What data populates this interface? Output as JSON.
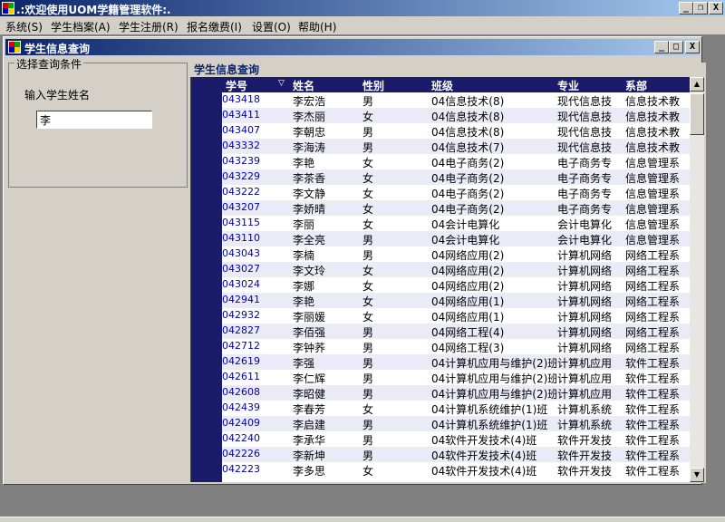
{
  "window": {
    "title": ".:欢迎使用UOM学籍管理软件:.",
    "minimize": "_",
    "restore": "❐",
    "close": "X"
  },
  "menu": [
    "系统(S)",
    "学生档案(A)",
    "学生注册(R)",
    "报名缴费(I)",
    "设置(O)",
    "帮助(H)"
  ],
  "child": {
    "title": "学生信息查询",
    "minimize": "_",
    "maximize": "□",
    "close": "X"
  },
  "search": {
    "group_title": "选择查询条件",
    "label": "输入学生姓名",
    "value": "李"
  },
  "results": {
    "caption": "学生信息查询",
    "columns": [
      "学号",
      "姓名",
      "性别",
      "班级",
      "专业",
      "系部"
    ],
    "sort_indicator": "▽",
    "rows": [
      [
        "043418",
        "李宏浩",
        "男",
        "04信息技术(8)",
        "现代信息技",
        "信息技术教"
      ],
      [
        "043411",
        "李杰丽",
        "女",
        "04信息技术(8)",
        "现代信息技",
        "信息技术教"
      ],
      [
        "043407",
        "李朝忠",
        "男",
        "04信息技术(8)",
        "现代信息技",
        "信息技术教"
      ],
      [
        "043332",
        "李海涛",
        "男",
        "04信息技术(7)",
        "现代信息技",
        "信息技术教"
      ],
      [
        "043239",
        "李艳",
        "女",
        "04电子商务(2)",
        "电子商务专",
        "信息管理系"
      ],
      [
        "043229",
        "李茶香",
        "女",
        "04电子商务(2)",
        "电子商务专",
        "信息管理系"
      ],
      [
        "043222",
        "李文静",
        "女",
        "04电子商务(2)",
        "电子商务专",
        "信息管理系"
      ],
      [
        "043207",
        "李娇晴",
        "女",
        "04电子商务(2)",
        "电子商务专",
        "信息管理系"
      ],
      [
        "043115",
        "李丽",
        "女",
        "04会计电算化",
        "会计电算化",
        "信息管理系"
      ],
      [
        "043110",
        "李全亮",
        "男",
        "04会计电算化",
        "会计电算化",
        "信息管理系"
      ],
      [
        "043043",
        "李楠",
        "男",
        "04网络应用(2)",
        "计算机网络",
        "网络工程系"
      ],
      [
        "043027",
        "李文玲",
        "女",
        "04网络应用(2)",
        "计算机网络",
        "网络工程系"
      ],
      [
        "043024",
        "李娜",
        "女",
        "04网络应用(2)",
        "计算机网络",
        "网络工程系"
      ],
      [
        "042941",
        "李艳",
        "女",
        "04网络应用(1)",
        "计算机网络",
        "网络工程系"
      ],
      [
        "042932",
        "李丽媛",
        "女",
        "04网络应用(1)",
        "计算机网络",
        "网络工程系"
      ],
      [
        "042827",
        "李佰强",
        "男",
        "04网络工程(4)",
        "计算机网络",
        "网络工程系"
      ],
      [
        "042712",
        "李钟荞",
        "男",
        "04网络工程(3)",
        "计算机网络",
        "网络工程系"
      ],
      [
        "042619",
        "李强",
        "男",
        "04计算机应用与维护(2)班",
        "计算机应用",
        "软件工程系"
      ],
      [
        "042611",
        "李仁辉",
        "男",
        "04计算机应用与维护(2)班",
        "计算机应用",
        "软件工程系"
      ],
      [
        "042608",
        "李昭健",
        "男",
        "04计算机应用与维护(2)班",
        "计算机应用",
        "软件工程系"
      ],
      [
        "042439",
        "李春芳",
        "女",
        "04计算机系统维护(1)班",
        "计算机系统",
        "软件工程系"
      ],
      [
        "042409",
        "李启建",
        "男",
        "04计算机系统维护(1)班",
        "计算机系统",
        "软件工程系"
      ],
      [
        "042240",
        "李承华",
        "男",
        "04软件开发技术(4)班",
        "软件开发技",
        "软件工程系"
      ],
      [
        "042226",
        "李新坤",
        "男",
        "04软件开发技术(4)班",
        "软件开发技",
        "软件工程系"
      ],
      [
        "042223",
        "李多思",
        "女",
        "04软件开发技术(4)班",
        "软件开发技",
        "软件工程系"
      ]
    ]
  },
  "scrollbar": {
    "up": "▲",
    "down": "▼"
  }
}
